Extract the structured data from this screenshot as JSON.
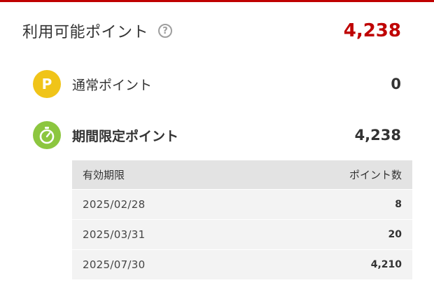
{
  "header": {
    "title": "利用可能ポイント",
    "help_icon": "question-circle-icon",
    "total_points": "4,238"
  },
  "regular_points": {
    "icon": "point-p-icon",
    "icon_letter": "P",
    "label": "通常ポイント",
    "value": "0"
  },
  "limited_points": {
    "icon": "stopwatch-icon",
    "label": "期間限定ポイント",
    "value": "4,238"
  },
  "expiry_table": {
    "headers": {
      "date": "有効期限",
      "points": "ポイント数"
    },
    "rows": [
      {
        "date": "2025/02/28",
        "points": "8"
      },
      {
        "date": "2025/03/31",
        "points": "20"
      },
      {
        "date": "2025/07/30",
        "points": "4,210"
      }
    ]
  },
  "colors": {
    "accent_red": "#bf0000",
    "p_badge": "#f0c419",
    "timer_badge": "#8cc63f",
    "table_header_bg": "#e3e3e3",
    "table_row_bg": "#f3f3f3"
  }
}
